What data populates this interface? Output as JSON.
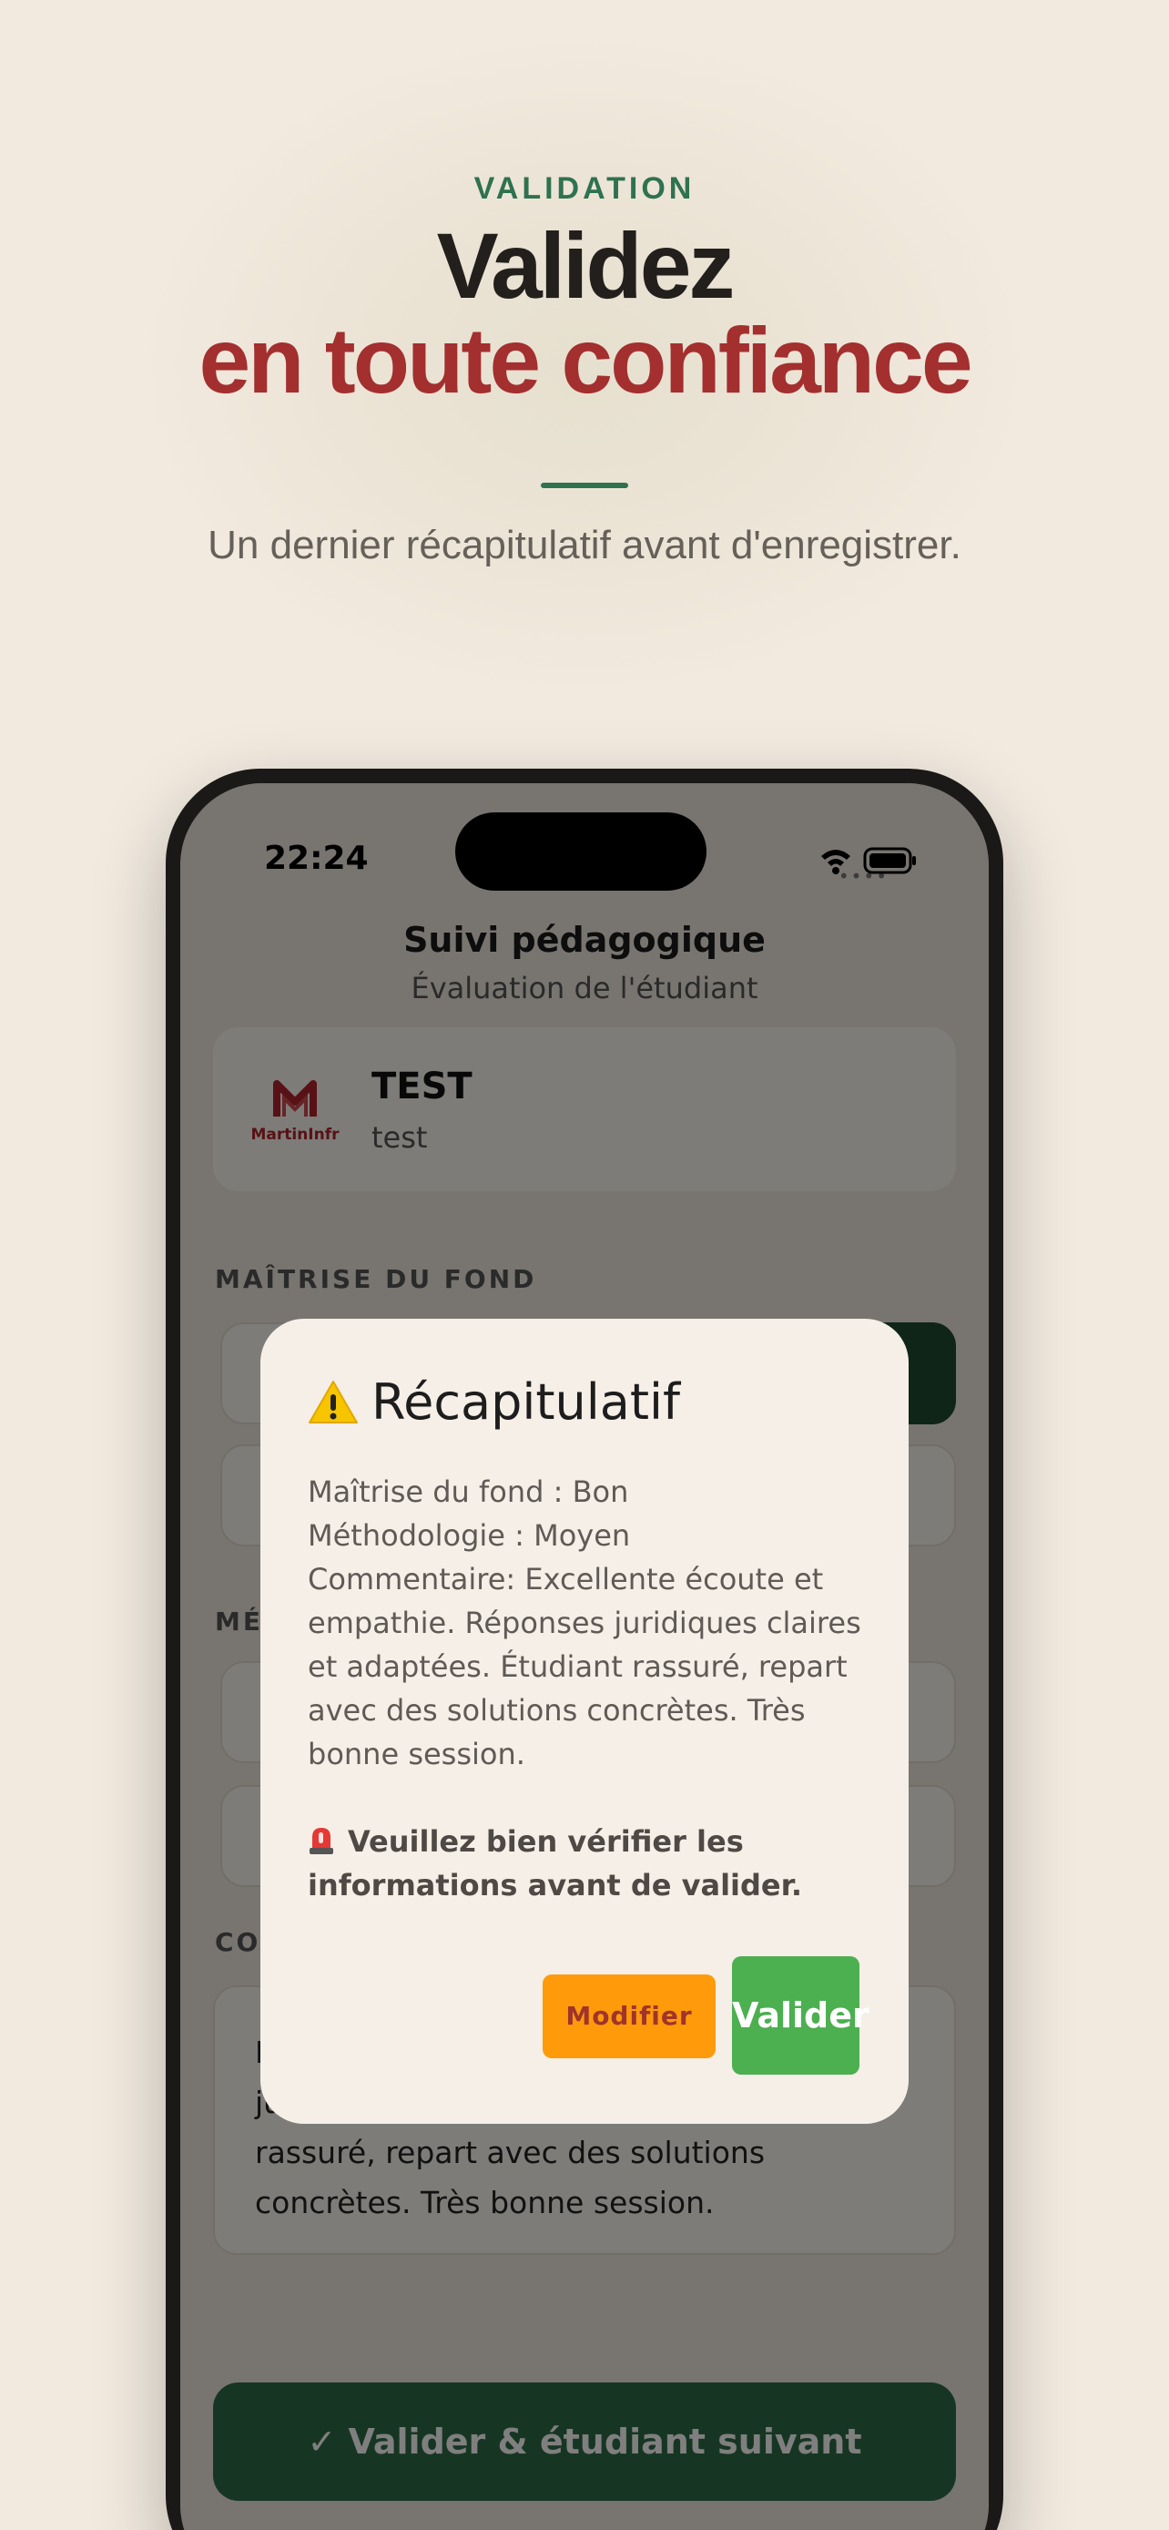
{
  "hero": {
    "eyebrow": "VALIDATION",
    "title_line1": "Validez",
    "title_line2": "en toute confiance",
    "subtitle": "Un dernier récapitulatif avant d'enregistrer."
  },
  "colors": {
    "accent_green": "#2e7250",
    "accent_red": "#a32f2f",
    "background": "#f2eadf",
    "modify_button": "#ff9b0a",
    "validate_button": "#4caf50",
    "cta_green": "#2d6d47"
  },
  "status_bar": {
    "time": "22:24",
    "icons": [
      "signal-icon",
      "wifi-icon",
      "battery-icon"
    ]
  },
  "app": {
    "title": "Suivi pédagogique",
    "subtitle": "Évaluation de l'étudiant",
    "logo_text": "MartinInfr",
    "student_name": "TEST",
    "student_sub": "test",
    "section_fond": "MAÎTRISE DU FOND",
    "section_methodo_fragment": "MÉ",
    "section_comment_fragment": "CO",
    "comment_visible_fragment1": "E",
    "comment_visible_fragment2": "ju",
    "comment_visible_line3": "rassuré, repart avec des solutions",
    "comment_visible_line4": "concrètes. Très bonne session.",
    "cta_label": "✓ Valider & étudiant suivant"
  },
  "modal": {
    "title": "Récapitulatif",
    "title_icon": "warning-icon",
    "line_fond": "Maîtrise du fond : Bon",
    "line_methodo": "Méthodologie : Moyen",
    "line_comment": "Commentaire: Excellente écoute et empathie. Réponses juridiques claires et adaptées. Étudiant rassuré, repart avec des solutions concrètes. Très bonne session.",
    "warning_icon": "siren-icon",
    "warning_text": "Veuillez bien vérifier les informations avant de valider.",
    "modify_label": "Modifier",
    "validate_label": "Valider"
  }
}
